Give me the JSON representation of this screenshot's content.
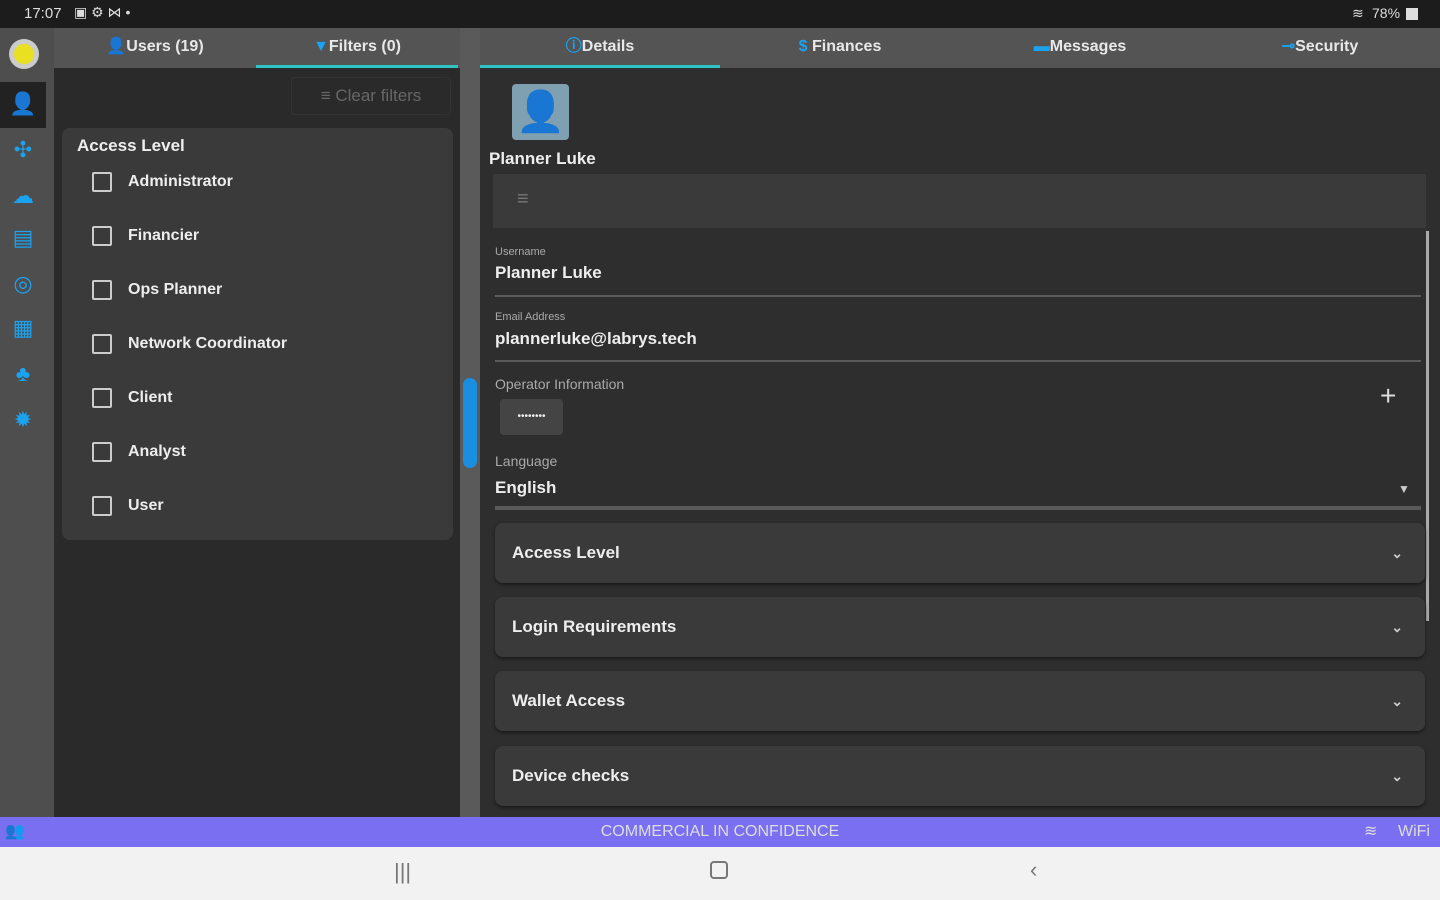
{
  "status_bar": {
    "time": "17:07",
    "battery": "78%"
  },
  "left_tabs": [
    {
      "label": "Users (19)",
      "icon": "user-icon"
    },
    {
      "label": "Filters (0)",
      "icon": "filter-icon"
    }
  ],
  "clear_filters": "Clear filters",
  "filters": {
    "title": "Access Level",
    "options": [
      "Administrator",
      "Financier",
      "Ops Planner",
      "Network Coordinator",
      "Client",
      "Analyst",
      "User"
    ]
  },
  "right_tabs": [
    {
      "label": "Details",
      "icon": "info-icon"
    },
    {
      "label": "Finances",
      "icon": "dollar-icon"
    },
    {
      "label": "Messages",
      "icon": "message-icon"
    },
    {
      "label": "Security",
      "icon": "key-icon"
    }
  ],
  "profile": {
    "name": "Planner Luke"
  },
  "fields": {
    "username_label": "Username",
    "username": "Planner Luke",
    "email_label": "Email Address",
    "email": "plannerluke@labrys.tech",
    "operator_label": "Operator Information",
    "operator_chip": "••••••••",
    "language_label": "Language",
    "language": "English"
  },
  "sections": [
    "Access Level",
    "Login Requirements",
    "Wallet Access",
    "Device checks"
  ],
  "banner": {
    "text": "COMMERCIAL IN CONFIDENCE",
    "network": "WiFi"
  },
  "colors": {
    "accent": "#1aa3f0",
    "tab_underline": "#2ec4c4",
    "banner": "#7a6ff0"
  }
}
